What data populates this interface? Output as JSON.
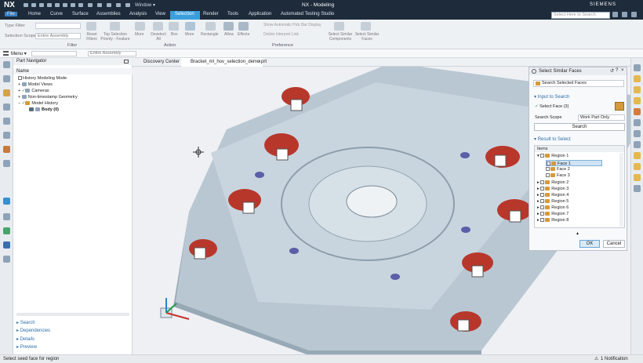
{
  "app": {
    "logo": "NX",
    "title": "NX - Modeling",
    "brand": "SIEMENS",
    "window_menu": "Window",
    "window_menu_arrow": "▾",
    "notification": "1 Notification"
  },
  "ribbon_tabs": [
    "File",
    "Home",
    "Curve",
    "Surface",
    "Assemblies",
    "Analysis",
    "View",
    "Selection",
    "Render",
    "Tools",
    "Application",
    "Automated Testing Studio"
  ],
  "search": {
    "placeholder": "Select Here to Search"
  },
  "ribbon": {
    "type_filter": "Type Filter",
    "selection_scope_label": "Selection Scope",
    "selection_scope_value": "Entire Assembly",
    "reset_filters": "Reset Filters",
    "top_selection_priority": "Top Selection Priority - Feature",
    "more": "More",
    "deselect_all": "Deselect All",
    "box": "Box",
    "rectangle": "Rectangle",
    "allow": "Allow",
    "effects": "Effects",
    "show_auto_pick": "Show Automatic Pick Bar Display",
    "delete_interpret": "Delete Interpret Link",
    "select_similar_components": "Select Similar Components",
    "select_similar_faces": "Select Similar Faces",
    "group_filter": "Filter",
    "group_action": "Action",
    "group_preference": "Preference"
  },
  "cmdbar": {
    "menu": "Menu",
    "menu_arrow": "▾",
    "filter_value": "Entire Assembly"
  },
  "nav": {
    "title": "Part Navigator",
    "column": "Name",
    "rows": [
      {
        "label": "History Modeling Mode",
        "indent": 0
      },
      {
        "label": "Model Views",
        "indent": 0
      },
      {
        "label": "Cameras",
        "indent": 0
      },
      {
        "label": "Non-timestamp Geometry",
        "indent": 0
      },
      {
        "label": "Model History",
        "indent": 0
      },
      {
        "label": "Body (0)",
        "indent": 1
      }
    ],
    "sections": [
      "Search",
      "Dependencies",
      "Details",
      "Preview"
    ]
  },
  "doc_tabs": [
    "Discovery Center",
    "Bracket_ml_hov_selection_demo.prt"
  ],
  "panel": {
    "title": "Select Similar Faces",
    "search_selected": "Search Selected Faces",
    "input_to_search": "Input to Search",
    "select_face": "Select Face (3)",
    "search_scope_label": "Search Scope",
    "search_scope_value": "Work Part Only",
    "search_button": "Search",
    "result_to_select": "Result to Select",
    "items_label": "Items",
    "tree": [
      {
        "label": "Region 1",
        "level": 0
      },
      {
        "label": "Face 1",
        "level": 1
      },
      {
        "label": "Face 2",
        "level": 1
      },
      {
        "label": "Face 3",
        "level": 1
      },
      {
        "label": "Region 2",
        "level": 0
      },
      {
        "label": "Region 3",
        "level": 0
      },
      {
        "label": "Region 4",
        "level": 0
      },
      {
        "label": "Region 5",
        "level": 0
      },
      {
        "label": "Region 6",
        "level": 0
      },
      {
        "label": "Region 7",
        "level": 0
      },
      {
        "label": "Region 8",
        "level": 0
      }
    ],
    "ok": "OK",
    "cancel": "Cancel"
  },
  "status": {
    "text": "Select seed face for region"
  },
  "colors": {
    "titlebar": "#1d2b3a",
    "accent": "#3a9fdc",
    "part": "#c3d0da",
    "hole": "#b8372b"
  }
}
